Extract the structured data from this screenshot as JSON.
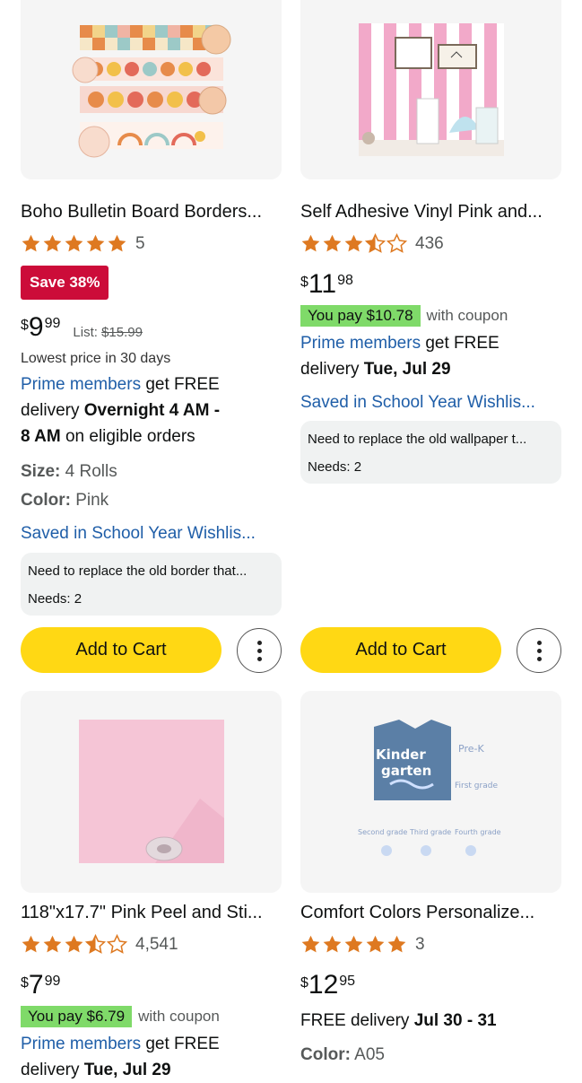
{
  "products": [
    {
      "title": "Boho Bulletin Board Borders...",
      "rating": 5,
      "rating_count": "5",
      "save_badge": "Save 38%",
      "price_currency": "$",
      "price_whole": "9",
      "price_fraction": "99",
      "list_label": "List:",
      "list_price": "$15.99",
      "lowest_price_note": "Lowest price in 30 days",
      "prime_link": "Prime members",
      "prime_rest": " get FREE",
      "delivery_word": "delivery ",
      "delivery_bold_1": "Overnight 4 AM -",
      "delivery_bold_2": "8 AM",
      "delivery_rest": " on eligible orders",
      "size_label": "Size:",
      "size_value": "4 Rolls",
      "color_label": "Color:",
      "color_value": "Pink",
      "saved_list": "Saved in School Year Wishlis...",
      "note_text": "Need to replace the old border that...",
      "needs": "Needs: 2",
      "cart_label": "Add to Cart"
    },
    {
      "title": "Self Adhesive Vinyl Pink and...",
      "rating": 4,
      "rating_count": "436",
      "price_currency": "$",
      "price_whole": "11",
      "price_fraction": "98",
      "coupon_pay": "You pay $10.78",
      "coupon_with": "with coupon",
      "prime_link": "Prime members",
      "prime_rest": " get FREE",
      "delivery_word": "delivery ",
      "delivery_bold": "Tue, Jul 29",
      "saved_list": "Saved in School Year Wishlis...",
      "note_text": "Need to replace the old wallpaper t...",
      "needs": "Needs: 2",
      "cart_label": "Add to Cart"
    },
    {
      "title": "118\"x17.7\" Pink Peel and Sti...",
      "rating": 4,
      "rating_count": "4,541",
      "price_currency": "$",
      "price_whole": "7",
      "price_fraction": "99",
      "coupon_pay": "You pay $6.79",
      "coupon_with": "with coupon",
      "prime_link": "Prime members",
      "prime_rest": " get FREE",
      "delivery_word": "delivery ",
      "delivery_bold": "Tue, Jul 29"
    },
    {
      "title": "Comfort Colors Personalize...",
      "rating": 5,
      "rating_count": "3",
      "price_currency": "$",
      "price_whole": "12",
      "price_fraction": "95",
      "free_delivery": "FREE delivery ",
      "free_delivery_bold": "Jul 30 - 31",
      "color_label": "Color:",
      "color_value": "A05"
    }
  ],
  "shirt_text": {
    "main_1": "Kinder",
    "main_2": "garten",
    "small_1": "Pre-K",
    "small_2": "First grade",
    "small_3": "Second grade",
    "small_4": "Third grade",
    "small_5": "Fourth grade"
  },
  "colors": {
    "star": "#de7921",
    "save_badge": "#cc0c39",
    "coupon": "#7fda69",
    "link": "#1f5ea8",
    "cart_button": "#ffd814"
  }
}
